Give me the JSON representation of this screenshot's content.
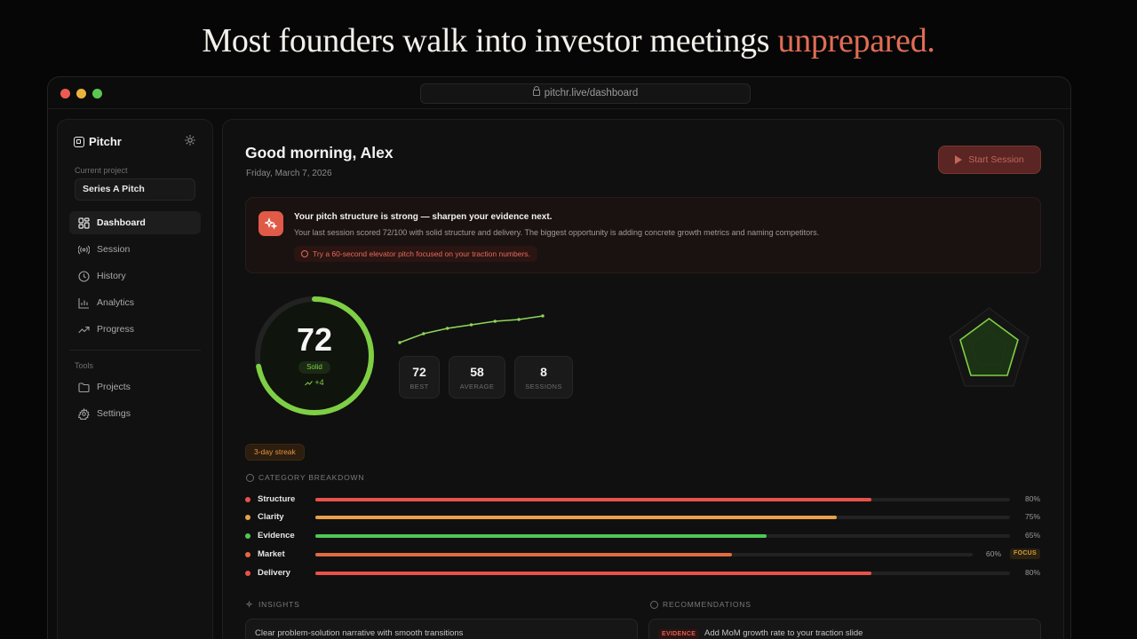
{
  "headline": {
    "text": "Most founders walk into investor meetings",
    "accent": "unprepared."
  },
  "browser": {
    "url": "pitchr.live/dashboard"
  },
  "sidebar": {
    "brand": "Pitchr",
    "current_project_label": "Current project",
    "current_project": "Series A Pitch",
    "nav": [
      {
        "label": "Dashboard",
        "icon": "dashboard-icon",
        "active": true
      },
      {
        "label": "Session",
        "icon": "broadcast-icon"
      },
      {
        "label": "History",
        "icon": "clock-icon"
      },
      {
        "label": "Analytics",
        "icon": "bar-chart-icon"
      },
      {
        "label": "Progress",
        "icon": "trend-icon"
      }
    ],
    "tools_label": "Tools",
    "tools": [
      {
        "label": "Projects",
        "icon": "folder-icon"
      },
      {
        "label": "Settings",
        "icon": "gear-icon"
      }
    ]
  },
  "main": {
    "greeting": "Good morning, Alex",
    "date": "Friday, March 7, 2026",
    "start_button": "Start Session",
    "banner": {
      "title": "Your pitch structure is strong — sharpen your evidence next.",
      "body": "Your last session scored 72/100 with solid structure and delivery. The biggest opportunity is adding concrete growth metrics and naming competitors.",
      "tip": "Try a 60-second elevator pitch focused on your traction numbers."
    },
    "score": {
      "value": "72",
      "max": 100,
      "label": "Solid",
      "delta": "+4"
    },
    "trend": [
      57,
      62,
      65,
      67,
      69,
      70,
      72
    ],
    "stats": [
      {
        "value": "72",
        "label": "BEST"
      },
      {
        "value": "58",
        "label": "AVERAGE"
      },
      {
        "value": "8",
        "label": "SESSIONS"
      }
    ],
    "streak": "3-day streak",
    "category_label": "CATEGORY BREAKDOWN",
    "categories": [
      {
        "name": "Structure",
        "value": 80,
        "pct": "80%",
        "color": "#e8524a"
      },
      {
        "name": "Clarity",
        "value": 75,
        "pct": "75%",
        "color": "#e8a04a"
      },
      {
        "name": "Evidence",
        "value": 65,
        "pct": "65%",
        "color": "#4fc857"
      },
      {
        "name": "Market",
        "value": 60,
        "pct": "60%",
        "color": "#e36a40",
        "badge": "FOCUS"
      },
      {
        "name": "Delivery",
        "value": 80,
        "pct": "80%",
        "color": "#e8524a"
      }
    ],
    "insights_label": "INSIGHTS",
    "insight": "Clear problem-solution narrative with smooth transitions",
    "recommendations_label": "RECOMMENDATIONS",
    "recommendation": {
      "tag": "EVIDENCE",
      "text": "Add MoM growth rate to your traction slide"
    }
  },
  "colors": {
    "accent": "#e06d55",
    "score_green": "#7fcf45"
  }
}
